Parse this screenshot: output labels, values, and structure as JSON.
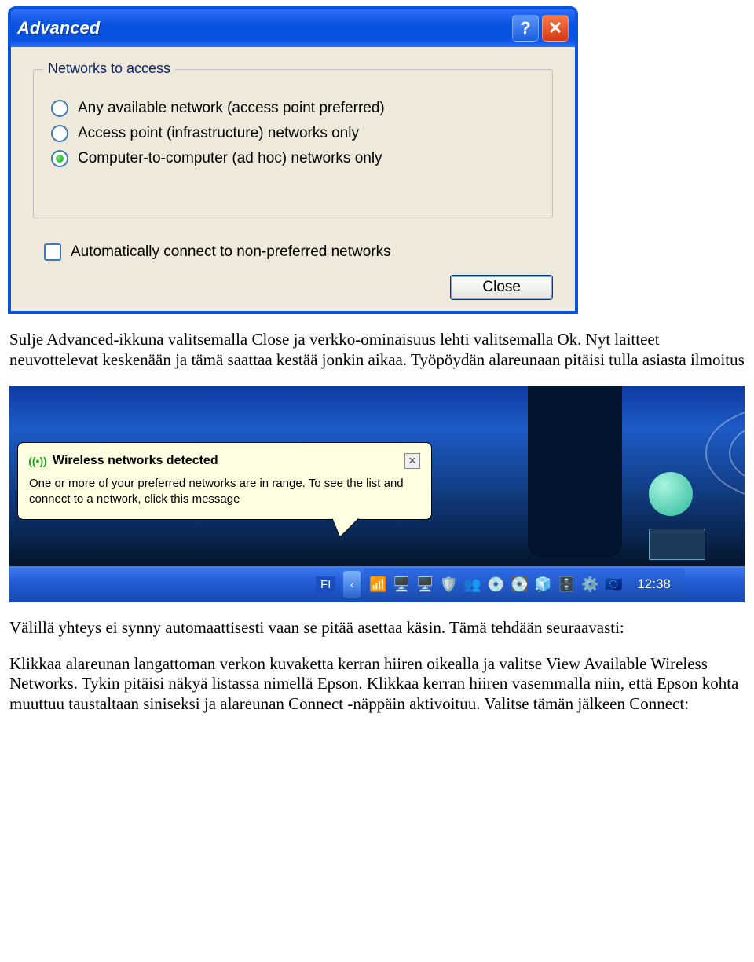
{
  "advanced_dialog": {
    "title": "Advanced",
    "groupbox_legend": "Networks to access",
    "options": [
      {
        "label": "Any available network (access point preferred)",
        "checked": false
      },
      {
        "label": "Access point (infrastructure) networks only",
        "checked": false
      },
      {
        "label": "Computer-to-computer (ad hoc) networks only",
        "checked": true
      }
    ],
    "checkbox_label": "Automatically connect to non-preferred networks",
    "close_button": "Close"
  },
  "doc": {
    "para1": "Sulje Advanced-ikkuna valitsemalla Close ja verkko-ominaisuus lehti valitsemalla Ok. Nyt laitteet neuvottelevat keskenään ja tämä saattaa kestää jonkin aikaa. Työpöydän alareunaan pitäisi tulla asiasta ilmoitus",
    "para2": "Välillä yhteys ei synny automaattisesti vaan se pitää asettaa käsin. Tämä tehdään seuraavasti:",
    "para3": "Klikkaa alareunan langattoman verkon kuvaketta kerran hiiren oikealla ja valitse View Available Wireless Networks. Tykin pitäisi näkyä listassa nimellä Epson. Klikkaa kerran hiiren vasemmalla niin, että Epson kohta muuttuu taustaltaan siniseksi ja alareunan Connect -näppäin aktivoituu. Valitse tämän jälkeen Connect:"
  },
  "balloon": {
    "icon_mark": "((•))",
    "title": "Wireless networks detected",
    "body": "One or more of your preferred networks are in range. To see the list and connect to a network, click this message"
  },
  "taskbar": {
    "language": "FI",
    "chevron": "‹",
    "clock": "12:38",
    "icons": [
      "wifi-icon",
      "monitor-icon",
      "monitor2-icon",
      "shield-icon",
      "users-icon",
      "disk-red-icon",
      "disk-blue-icon",
      "cube-icon",
      "db-icon",
      "gear-icon",
      "flag-icon"
    ]
  }
}
